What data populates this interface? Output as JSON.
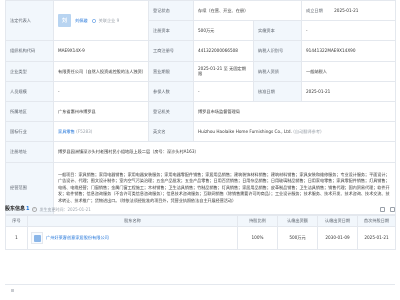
{
  "registration": {
    "legal_rep_label": "法定代表人",
    "legal_rep_logo_char": "刘",
    "legal_rep_name": "刘佩璇",
    "legal_rep_tag": "关联企业 9",
    "status_label": "登记状态",
    "status_value": "存续（在营、开业、在册）",
    "established_label": "成立日期",
    "established_value": "2025-01-21",
    "reg_capital_label": "注册资本",
    "reg_capital_value": "500万元",
    "paid_capital_label": "实缴资本",
    "paid_capital_value": "-",
    "org_code_label": "组织机构代码",
    "org_code_value": "MAE9X14X-9",
    "biz_reg_no_label": "工商注册号",
    "biz_reg_no_value": "441322000066508",
    "taxpayer_id_label": "纳税人识别号",
    "taxpayer_id_value": "91441322MAE9X14X90",
    "company_type_label": "企业类型",
    "company_type_value": "有限责任公司（自然人投资或控股的法人独资）",
    "biz_term_label": "营业期限",
    "biz_term_value": "2025-01-21 至 无固定期限",
    "taxpayer_qual_label": "纳税人资质",
    "taxpayer_qual_value": "一般纳税人",
    "staff_size_label": "人员规模",
    "staff_size_value": "-",
    "insured_label": "参保人数",
    "insured_value": "-",
    "approval_date_label": "核准日期",
    "approval_date_value": "2025-01-21",
    "region_label": "所属地区",
    "region_value": "广东省惠州市博罗县",
    "authority_label": "登记机关",
    "authority_value": "博罗县市场监督管理局",
    "industry_label": "国标行业",
    "industry_value": "家具零售",
    "industry_code": "(F5283)",
    "english_name_label": "英文名",
    "english_name_value": "Huizhou Haolaike Home Furnishings Co., Ltd.",
    "english_name_note": "(自动翻译参考)",
    "address_label": "注册地址",
    "address_value": "博罗县园洲镇深沙头村老围村民小组地段上段二层（房号：深沙头村A163）",
    "scope_label": "经营范围",
    "scope_value": "一般项目：家具销售；家用电器销售；家用电器安装服务；家用电器零配件销售；家居用品销售；建筑装饰材料销售；建筑材料销售；家具安装和维修服务；专业设计服务；平面设计；广告设计、代理；图文设计制作；室内空气污染治理；五金产品批发；五金产品零售；日用百货销售；日用杂品销售；日用玻璃制品销售；日用家电零售；家具零配件销售；灯具销售；电线、电缆经营；门窗销售；金属门窗工程施工；木材销售；卫生洁具销售；竹制品销售；灯具销售；家居用品销售；皮革制品销售；卫生洁具销售；销售代理；国内贸易代理；软件开发；软件销售；信息咨询服务（不含许可类信息咨询服务）；信息技术咨询服务；互联网销售（除销售需要许可的商品）；工业设计服务；技术服务、技术开发、技术咨询、技术交流、技术转让、技术推广；货物进出口。（除依法须经批准的项目外，凭营业执照依法自主开展经营活动）"
  },
  "shareholders": {
    "title": "股东信息",
    "count": "1",
    "note": "发生变更时间：2025-01-21",
    "col_index": "序号",
    "col_name": "股东名称",
    "col_ratio": "持股比例",
    "col_capital": "认缴出资额",
    "col_date": "认缴出资日期",
    "col_first": "首次持股日期",
    "rows": [
      {
        "index": "1",
        "name": "广州好莱客创意家居股份有限公司",
        "ratio": "100%",
        "capital": "500万元",
        "date": "2030-01-09",
        "first": "2025-01-21"
      }
    ]
  },
  "colors": {
    "label_bg": "#f2f7fc",
    "border": "#e4e8ee",
    "link": "#1a70d8"
  }
}
